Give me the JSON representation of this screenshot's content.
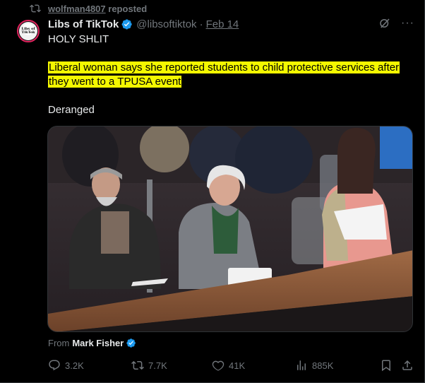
{
  "repost_banner": {
    "user": "wolfman4807",
    "suffix": " reposted"
  },
  "author": {
    "display_name": "Libs of TikTok",
    "handle": "@libsoftiktok",
    "separator": "·",
    "date": "Feb 14",
    "avatar_text": "Libs of TikTok"
  },
  "tweet": {
    "line1": "HOLY SHLIT",
    "highlight_1": "Liberal woman says she reported students to child protective services after",
    "highlight_2": "they went to a TPUSA event",
    "line3": "Deranged"
  },
  "media_credit": {
    "prefix": "From",
    "name": "Mark Fisher"
  },
  "stats": {
    "replies": "3.2K",
    "reposts": "7.7K",
    "likes": "41K",
    "views": "885K"
  },
  "colors": {
    "background": "#000000",
    "text": "#e7e9ea",
    "muted": "#71767b",
    "verified": "#1d9bf0",
    "highlight": "#f4f800",
    "avatar_ring": "#e0245e"
  },
  "icons": [
    "repost-icon",
    "verified-badge-icon",
    "grok-icon",
    "more-icon",
    "reply-icon",
    "like-icon",
    "views-icon",
    "bookmark-icon",
    "share-icon"
  ]
}
